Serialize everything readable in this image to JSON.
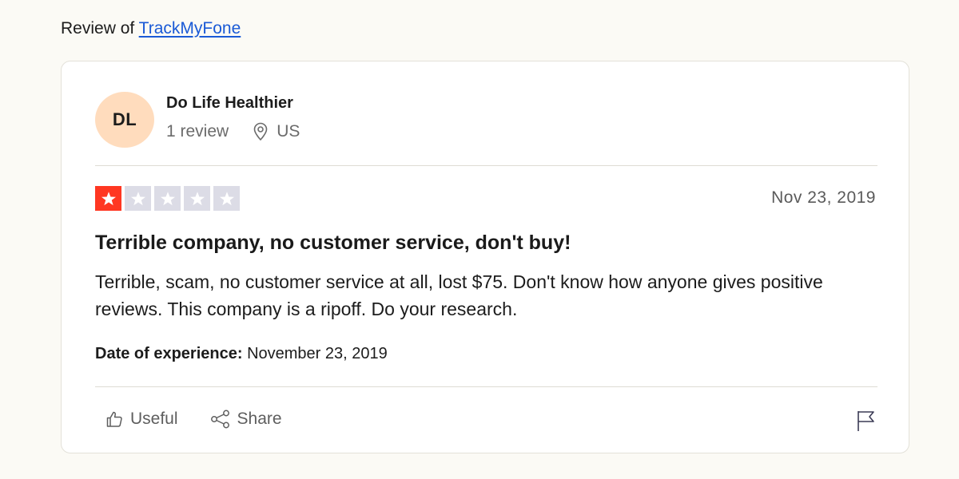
{
  "header": {
    "prefix": "Review of",
    "company_link": "TrackMyFone"
  },
  "reviewer": {
    "initials": "DL",
    "name": "Do Life Healthier",
    "review_count": "1 review",
    "location": "US",
    "avatar_color": "#ffdcbd"
  },
  "review": {
    "rating": 1,
    "rating_max": 5,
    "star_color_filled": "#ff3722",
    "star_color_empty": "#dcdce6",
    "date": "Nov 23, 2019",
    "title": "Terrible company, no customer service, don't buy!",
    "body": "Terrible, scam, no customer service at all, lost $75. Don't know how anyone gives positive reviews. This company is a ripoff. Do your research.",
    "experience_label": "Date of experience:",
    "experience_date": "November 23, 2019"
  },
  "actions": {
    "useful_label": "Useful",
    "share_label": "Share",
    "useful_icon": "thumbs-up-icon",
    "share_icon": "share-icon",
    "flag_icon": "flag-icon"
  }
}
